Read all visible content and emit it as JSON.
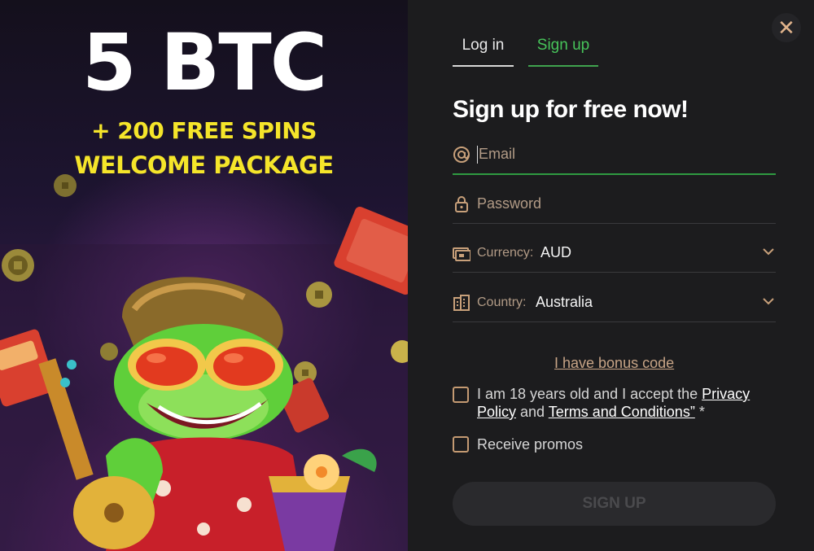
{
  "promo": {
    "headline": "5 BTC",
    "line1": "+ 200 FREE SPINS",
    "line2": "WELCOME PACKAGE"
  },
  "tabs": {
    "login": "Log in",
    "signup": "Sign up",
    "active": "signup"
  },
  "close_icon": "close-x-icon",
  "heading": "Sign up for free now!",
  "fields": {
    "email": {
      "placeholder": "Email",
      "icon": "at-sign-icon"
    },
    "password": {
      "placeholder": "Password",
      "icon": "lock-icon"
    },
    "currency": {
      "label": "Currency:",
      "value": "AUD",
      "icon": "currency-notes-icon"
    },
    "country": {
      "label": "Country:",
      "value": "Australia",
      "icon": "building-icon"
    }
  },
  "bonus_link": "I have bonus code",
  "consent": {
    "prefix": "I am 18 years old and I accept the ",
    "privacy": "Privacy Policy",
    "and": " and ",
    "terms": "Terms and Conditions”",
    "suffix": " *"
  },
  "promos_label": "Receive promos",
  "submit_label": "SIGN UP",
  "colors": {
    "accent_green": "#3fa34e",
    "promo_yellow": "#f5e52a",
    "icon_tan": "#c8a07a"
  }
}
